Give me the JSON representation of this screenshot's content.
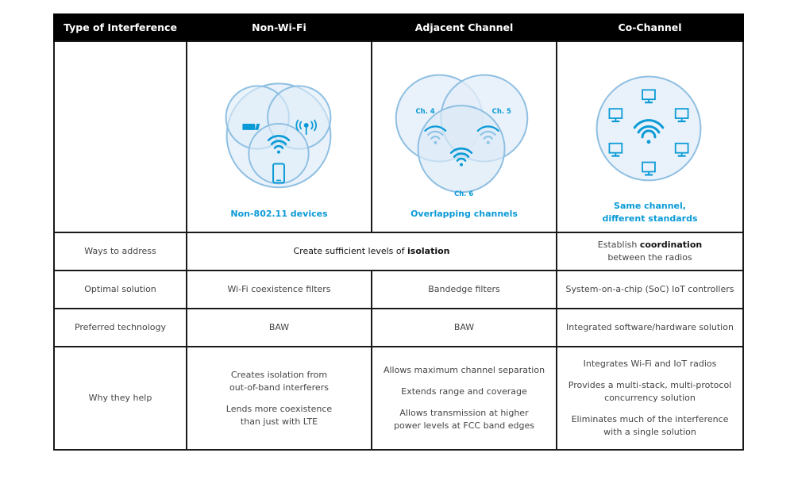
{
  "header": {
    "col0": "Type of Interference",
    "col1": "Non-Wi-Fi",
    "col2": "Adjacent Channel",
    "col3": "Co-Channel"
  },
  "diagrams": {
    "non_wifi": {
      "caption": "Non-802.11 devices",
      "icons": [
        "usb-dongle-icon",
        "broadcast-antenna-icon",
        "wifi-icon",
        "smartphone-icon"
      ]
    },
    "adjacent": {
      "caption": "Overlapping channels",
      "labels": [
        "Ch. 4",
        "Ch. 5",
        "Ch. 6"
      ],
      "icons": [
        "wifi-icon",
        "wifi-icon",
        "wifi-icon"
      ]
    },
    "co_channel": {
      "caption_line1": "Same channel,",
      "caption_line2": "different standards",
      "icons": [
        "monitor-icon",
        "monitor-icon",
        "monitor-icon",
        "monitor-icon",
        "monitor-icon",
        "monitor-icon",
        "wifi-icon"
      ]
    }
  },
  "colors": {
    "accent": "#0a9ad6",
    "circle_fill": "#e6f0fa",
    "circle_stroke": "#8ebfe2",
    "header_bg": "#000000"
  },
  "rows": {
    "ways": {
      "label": "Ways to address",
      "merged_pre": "Create sufficient levels of ",
      "merged_bold": "isolation",
      "co_pre": "Establish ",
      "co_bold": "coordination",
      "co_post": "between the radios"
    },
    "optimal": {
      "label": "Optimal solution",
      "non_wifi": "Wi-Fi coexistence filters",
      "adjacent": "Bandedge filters",
      "co_channel": "System-on-a-chip (SoC) IoT controllers"
    },
    "preferred": {
      "label": "Preferred technology",
      "non_wifi": "BAW",
      "adjacent": "BAW",
      "co_channel": "Integrated software/hardware solution"
    },
    "why": {
      "label": "Why they help",
      "non_wifi": [
        [
          "Creates isolation from",
          "out-of-band interferers"
        ],
        [
          "Lends more coexistence",
          "than just with LTE"
        ]
      ],
      "adjacent": [
        [
          "Allows maximum channel separation"
        ],
        [
          "Extends range and coverage"
        ],
        [
          "Allows transmission at higher",
          "power levels at FCC band edges"
        ]
      ],
      "co_channel": [
        [
          "Integrates Wi-Fi and IoT radios"
        ],
        [
          "Provides a multi-stack, multi-protocol",
          "concurrency solution"
        ],
        [
          "Eliminates much of the interference",
          "with a single solution"
        ]
      ]
    }
  }
}
